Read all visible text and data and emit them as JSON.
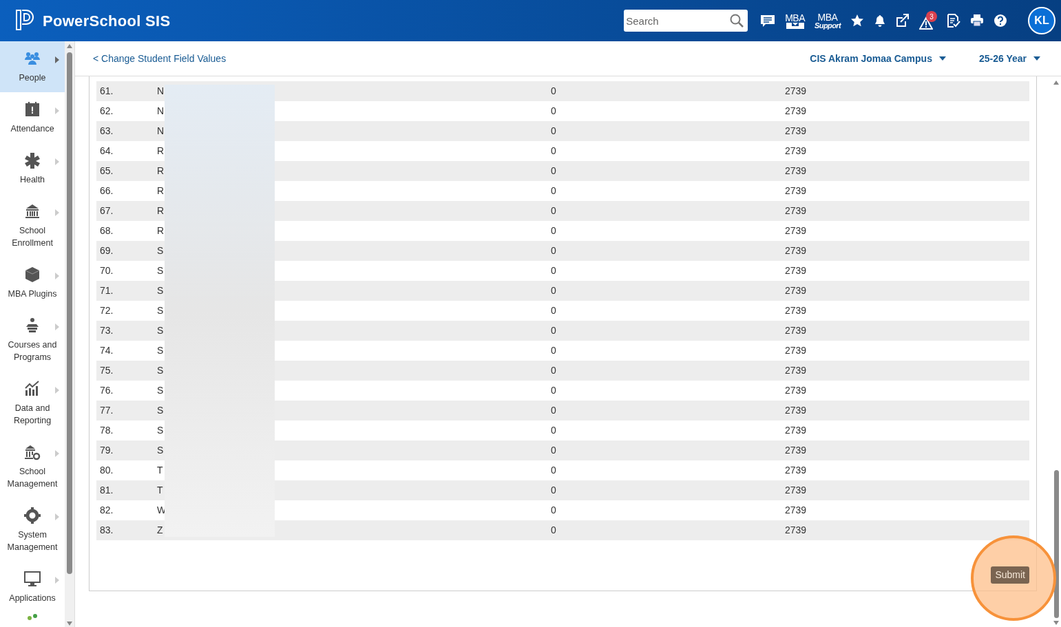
{
  "header": {
    "title": "PowerSchool SIS",
    "search": {
      "placeholder": "Search"
    },
    "mba_label": "MBA",
    "mba_support_label": "MBA",
    "mba_support_sub": "Support",
    "alert_count": "3",
    "avatar": "KL"
  },
  "sidebar": {
    "items": [
      {
        "label": "People",
        "selected": true
      },
      {
        "label": "Attendance",
        "selected": false
      },
      {
        "label": "Health",
        "selected": false
      },
      {
        "label": "School Enrollment",
        "selected": false
      },
      {
        "label": "MBA Plugins",
        "selected": false
      },
      {
        "label": "Courses and Programs",
        "selected": false
      },
      {
        "label": "Data and Reporting",
        "selected": false
      },
      {
        "label": "School Management",
        "selected": false
      },
      {
        "label": "System Management",
        "selected": false
      },
      {
        "label": "Applications",
        "selected": false
      }
    ]
  },
  "breadcrumb": "< Change Student Field Values",
  "school_selector": "CIS Akram Jomaa Campus",
  "year_selector": "25-26 Year",
  "table": {
    "rows": [
      {
        "number": "61.",
        "column_2": "N",
        "column_3": "0",
        "column_4": "2739"
      },
      {
        "number": "62.",
        "column_2": "N",
        "column_3": "0",
        "column_4": "2739"
      },
      {
        "number": "63.",
        "column_2": "N",
        "column_3": "0",
        "column_4": "2739"
      },
      {
        "number": "64.",
        "column_2": "R",
        "column_3": "0",
        "column_4": "2739"
      },
      {
        "number": "65.",
        "column_2": "R",
        "column_3": "0",
        "column_4": "2739"
      },
      {
        "number": "66.",
        "column_2": "R",
        "column_3": "0",
        "column_4": "2739"
      },
      {
        "number": "67.",
        "column_2": "R",
        "column_3": "0",
        "column_4": "2739"
      },
      {
        "number": "68.",
        "column_2": "R",
        "column_3": "0",
        "column_4": "2739"
      },
      {
        "number": "69.",
        "column_2": "S",
        "column_3": "0",
        "column_4": "2739"
      },
      {
        "number": "70.",
        "column_2": "S",
        "column_3": "0",
        "column_4": "2739"
      },
      {
        "number": "71.",
        "column_2": "S",
        "column_3": "0",
        "column_4": "2739"
      },
      {
        "number": "72.",
        "column_2": "S",
        "column_3": "0",
        "column_4": "2739"
      },
      {
        "number": "73.",
        "column_2": "S",
        "column_3": "0",
        "column_4": "2739"
      },
      {
        "number": "74.",
        "column_2": "S",
        "column_3": "0",
        "column_4": "2739"
      },
      {
        "number": "75.",
        "column_2": "S",
        "column_3": "0",
        "column_4": "2739"
      },
      {
        "number": "76.",
        "column_2": "S",
        "column_3": "0",
        "column_4": "2739"
      },
      {
        "number": "77.",
        "column_2": "S",
        "column_3": "0",
        "column_4": "2739"
      },
      {
        "number": "78.",
        "column_2": "S",
        "column_3": "0",
        "column_4": "2739"
      },
      {
        "number": "79.",
        "column_2": "S",
        "column_3": "0",
        "column_4": "2739"
      },
      {
        "number": "80.",
        "column_2": "T",
        "column_3": "0",
        "column_4": "2739"
      },
      {
        "number": "81.",
        "column_2": "T",
        "column_3": "0",
        "column_4": "2739"
      },
      {
        "number": "82.",
        "column_2": "W",
        "column_3": "0",
        "column_4": "2739"
      },
      {
        "number": "83.",
        "column_2": "Z",
        "column_3": "0",
        "column_4": "2739"
      }
    ]
  },
  "submit_button": "Submit"
}
